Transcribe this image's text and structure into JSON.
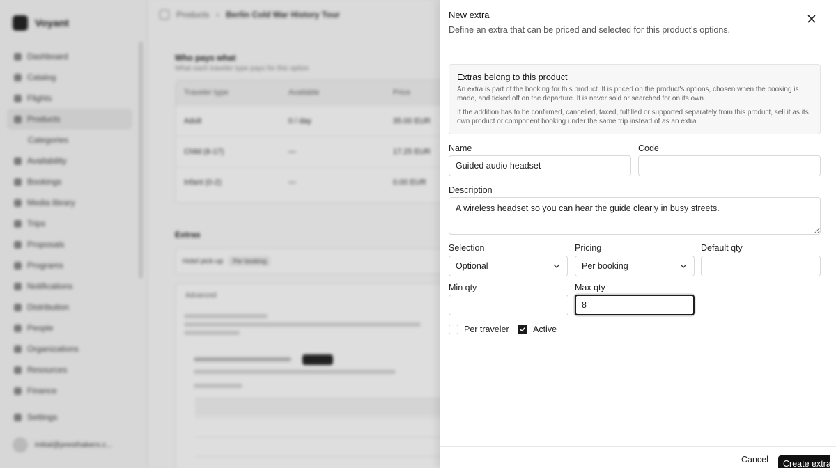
{
  "background": {
    "brand": "Voyant",
    "nav": [
      {
        "label": "Dashboard",
        "active": false,
        "sub": false
      },
      {
        "label": "Catalog",
        "active": false,
        "sub": false
      },
      {
        "label": "Flights",
        "active": false,
        "sub": false
      },
      {
        "label": "Products",
        "active": true,
        "sub": false
      },
      {
        "label": "Categories",
        "active": false,
        "sub": true
      },
      {
        "label": "Availability",
        "active": false,
        "sub": false
      },
      {
        "label": "Bookings",
        "active": false,
        "sub": false
      },
      {
        "label": "Media library",
        "active": false,
        "sub": false
      },
      {
        "label": "Trips",
        "active": false,
        "sub": false
      },
      {
        "label": "Proposals",
        "active": false,
        "sub": false
      },
      {
        "label": "Programs",
        "active": false,
        "sub": false
      },
      {
        "label": "Notifications",
        "active": false,
        "sub": false
      },
      {
        "label": "Distribution",
        "active": false,
        "sub": false
      },
      {
        "label": "People",
        "active": false,
        "sub": false
      },
      {
        "label": "Organizations",
        "active": false,
        "sub": false
      },
      {
        "label": "Resources",
        "active": false,
        "sub": false
      },
      {
        "label": "Finance",
        "active": false,
        "sub": false
      }
    ],
    "settings": "Settings",
    "user_email": "initial@presthakers.c...",
    "breadcrumb": {
      "root": "Products",
      "current": "Berlin Cold War History Tour"
    },
    "pricing_section": {
      "title": "Who pays what",
      "subtitle": "What each traveler type pays for this option",
      "columns": [
        "Traveler type",
        "Available",
        "Price"
      ],
      "rows": [
        {
          "type": "Adult",
          "available": "0 / day",
          "price": "35.00 EUR"
        },
        {
          "type": "Child (6-17)",
          "available": "—",
          "price": "17.25 EUR"
        },
        {
          "type": "Infant (0-2)",
          "available": "—",
          "price": "0.00 EUR"
        }
      ]
    },
    "extras_section": {
      "title": "Extras",
      "card_name": "Hotel pick-up",
      "card_chip": "Per booking",
      "advanced_label": "Advanced"
    }
  },
  "drawer": {
    "title": "New extra",
    "subtitle": "Define an extra that can be priced and selected for this product's options.",
    "info": {
      "title": "Extras belong to this product",
      "p1": "An extra is part of the booking for this product. It is priced on the product's options, chosen when the booking is made, and ticked off on the departure. It is never sold or searched for on its own.",
      "p2": "If the addition has to be confirmed, cancelled, taxed, fulfilled or supported separately from this product, sell it as its own product or component booking under the same trip instead of as an extra."
    },
    "fields": {
      "name_label": "Name",
      "name_value": "Guided audio headset",
      "code_label": "Code",
      "code_value": "",
      "description_label": "Description",
      "description_value": "A wireless headset so you can hear the guide clearly in busy streets.",
      "selection_label": "Selection",
      "selection_value": "Optional",
      "pricing_label": "Pricing",
      "pricing_value": "Per booking",
      "default_qty_label": "Default qty",
      "default_qty_value": "",
      "min_qty_label": "Min qty",
      "min_qty_value": "",
      "max_qty_label": "Max qty",
      "max_qty_value": "8"
    },
    "checkboxes": {
      "per_traveler_label": "Per traveler",
      "per_traveler_checked": false,
      "active_label": "Active",
      "active_checked": true
    },
    "buttons": {
      "cancel": "Cancel",
      "create": "Create extra"
    }
  }
}
